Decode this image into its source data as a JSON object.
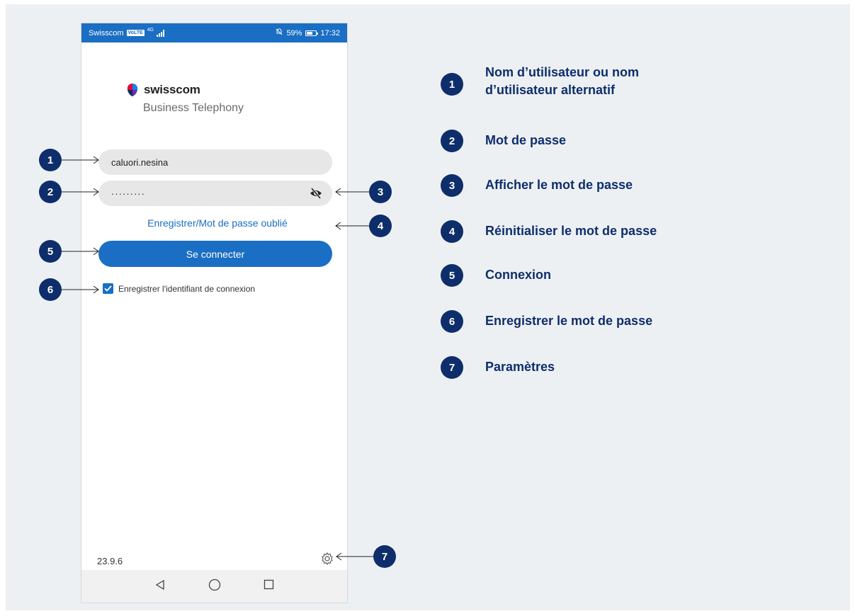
{
  "statusbar": {
    "carrier": "Swisscom",
    "net_badge": "VoLTE",
    "net_type": "4G",
    "battery": "59%",
    "time": "17:32"
  },
  "logo": {
    "name": "swisscom",
    "subtitle": "Business Telephony"
  },
  "login": {
    "username": "caluori.nesina",
    "password": "·········",
    "forgot_link": "Enregistrer/Mot de passe oublié",
    "connect_button": "Se connecter",
    "remember_label": "Enregistrer l'identifiant de connexion",
    "remember_checked": true
  },
  "footer": {
    "version": "23.9.6"
  },
  "callouts": [
    "1",
    "2",
    "3",
    "4",
    "5",
    "6",
    "7"
  ],
  "legend": [
    {
      "number": "1",
      "text": "Nom d’utilisateur ou nom d’utilisateur alternatif"
    },
    {
      "number": "2",
      "text": "Mot de passe"
    },
    {
      "number": "3",
      "text": "Afficher le mot de passe"
    },
    {
      "number": "4",
      "text": "Réinitialiser le mot de passe"
    },
    {
      "number": "5",
      "text": "Connexion"
    },
    {
      "number": "6",
      "text": "Enregistrer le mot de passe"
    },
    {
      "number": "7",
      "text": "Paramètres"
    }
  ],
  "colors": {
    "brand_blue": "#1a6ec3",
    "navy": "#0e2e6b",
    "panel_bg": "#edf0f3"
  },
  "icons": [
    "eye-slash-icon",
    "gear-icon",
    "checkbox-checked-icon",
    "back-triangle-icon",
    "home-circle-icon",
    "recents-square-icon"
  ]
}
